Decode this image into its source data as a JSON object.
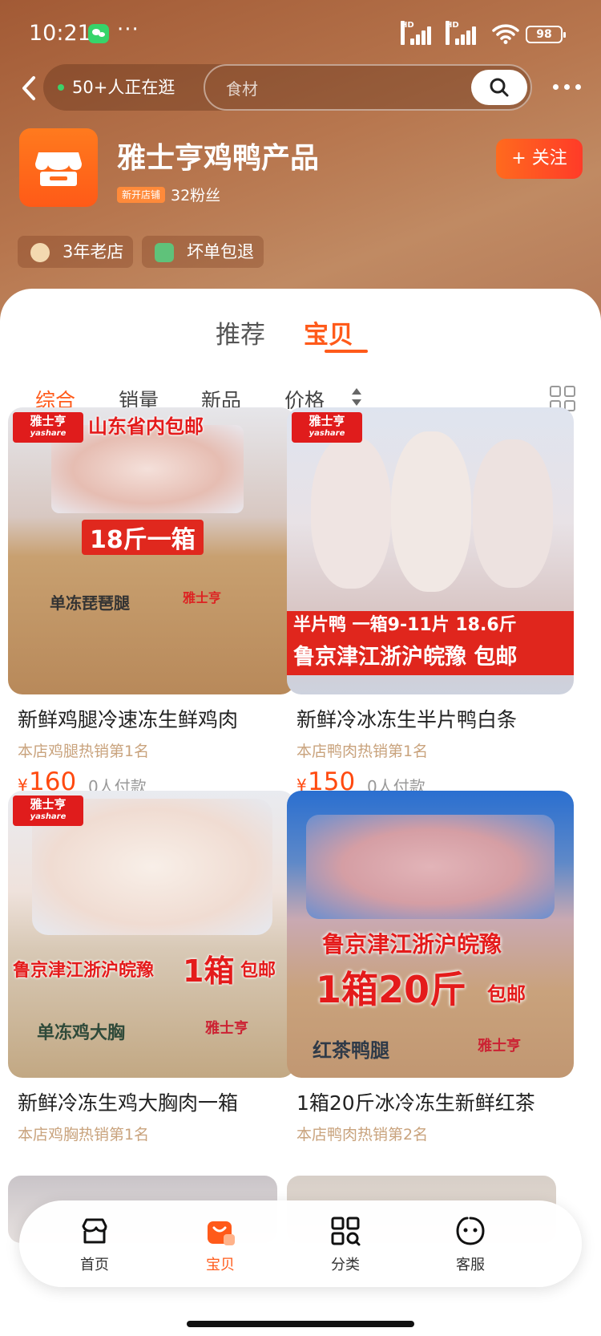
{
  "status_bar": {
    "time": "10:21",
    "dots": "···",
    "battery": "98",
    "hd1": "HD",
    "hd2": "HD"
  },
  "nav": {
    "live_text": "50+人正在逛",
    "search_placeholder": "食材"
  },
  "shop": {
    "name": "雅士亨鸡鸭产品",
    "new_tag": "新开店铺",
    "fans": "32粉丝",
    "follow_label": "+ 关注",
    "badges": [
      "3年老店",
      "坏单包退"
    ]
  },
  "tabs": {
    "recommend": "推荐",
    "products": "宝贝"
  },
  "sort": {
    "overall": "综合",
    "sales": "销量",
    "new": "新品",
    "price": "价格"
  },
  "brand": {
    "cn": "雅士亨",
    "en": "yashare"
  },
  "products": [
    {
      "title": "新鲜鸡腿冷速冻生鲜鸡肉",
      "rank": "本店鸡腿热销第1名",
      "currency": "¥",
      "price": "160",
      "sold": "0人付款",
      "img_text": [
        "山东省内包邮",
        "18斤一箱",
        "单冻琵琶腿",
        "雅士亨"
      ]
    },
    {
      "title": "新鲜冷冰冻生半片鸭白条",
      "rank": "本店鸭肉热销第1名",
      "currency": "¥",
      "price": "150",
      "sold": "0人付款",
      "img_text": [
        "半片鸭 一箱9-11片 18.6斤",
        "鲁京津江浙沪皖豫 包邮"
      ]
    },
    {
      "title": "新鲜冷冻生鸡大胸肉一箱",
      "rank": "本店鸡胸热销第1名",
      "img_text": [
        "鲁京津江浙沪皖豫",
        "1箱",
        "包邮",
        "单冻鸡大胸",
        "雅士亨"
      ]
    },
    {
      "title": "1箱20斤冰冷冻生新鲜红茶",
      "rank": "本店鸭肉热销第2名",
      "img_text": [
        "鲁京津江浙沪皖豫",
        "1箱20斤",
        "包邮",
        "红茶鸭腿",
        "雅士亨"
      ]
    }
  ],
  "bottom_nav": [
    "首页",
    "宝贝",
    "分类",
    "客服"
  ],
  "colors": {
    "accent": "#ff5a1a",
    "price": "#ff4a10",
    "header": "#b06a42"
  }
}
